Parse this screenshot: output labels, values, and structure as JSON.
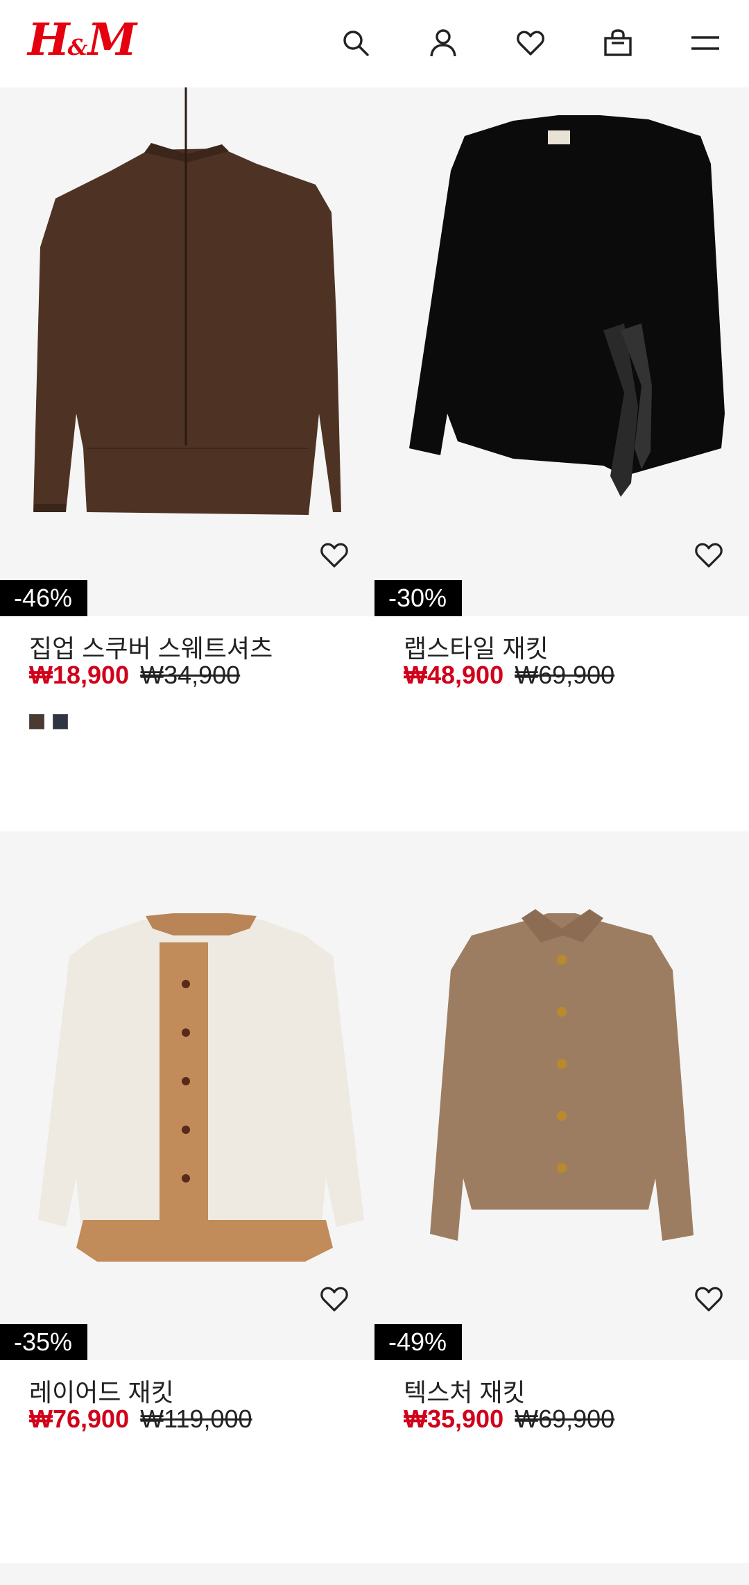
{
  "brand": {
    "logo_text": "H",
    "logo_amp": "&",
    "logo_m": "M",
    "color": "#e50010"
  },
  "header_icons": [
    "search-icon",
    "account-icon",
    "heart-icon",
    "shopping-bag-icon",
    "menu-icon"
  ],
  "products": [
    {
      "name": "집업 스쿠버 스웨트셔츠",
      "sale_price": "₩18,900",
      "original_price": "₩34,900",
      "discount": "-46%",
      "swatches": [
        "#4a3a32",
        "#2f3545"
      ]
    },
    {
      "name": "랩스타일 재킷",
      "sale_price": "₩48,900",
      "original_price": "₩69,900",
      "discount": "-30%"
    },
    {
      "name": "레이어드 재킷",
      "sale_price": "₩76,900",
      "original_price": "₩119,000",
      "discount": "-35%"
    },
    {
      "name": "텍스처 재킷",
      "sale_price": "₩35,900",
      "original_price": "₩69,900",
      "discount": "-49%"
    }
  ],
  "colors": {
    "sale": "#d0021b",
    "badge_bg": "#000000",
    "image_bg": "#f5f5f5"
  }
}
